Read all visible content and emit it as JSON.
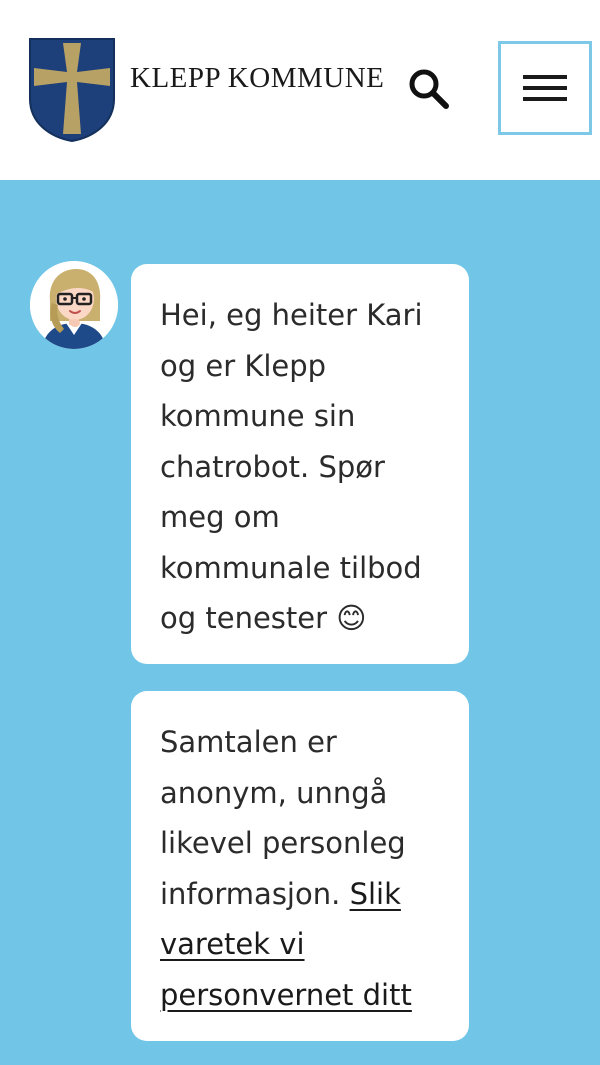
{
  "header": {
    "brand_name": "KLEPP KOMMUNE",
    "logo_icon": "klepp-coat-of-arms",
    "search_icon": "search-icon",
    "menu_icon": "hamburger-menu-icon"
  },
  "colors": {
    "header_bg": "#ffffff",
    "chat_bg": "#71c6e8",
    "bubble_bg": "#ffffff",
    "shield_blue": "#1d3f7a",
    "cross_gold": "#b8a164",
    "menu_border": "#7cc8e6"
  },
  "chat": {
    "bot_avatar": "bot-avatar-kari",
    "messages": [
      {
        "text": "Hei, eg heiter Kari og er Klepp kommune sin chatrobot. Spør meg om kommunale tilbod og tenester 😊"
      },
      {
        "text": "Samtalen er anonym, unngå likevel personleg informasjon. ",
        "link_text": "Slik varetek vi personvernet ditt"
      }
    ]
  }
}
